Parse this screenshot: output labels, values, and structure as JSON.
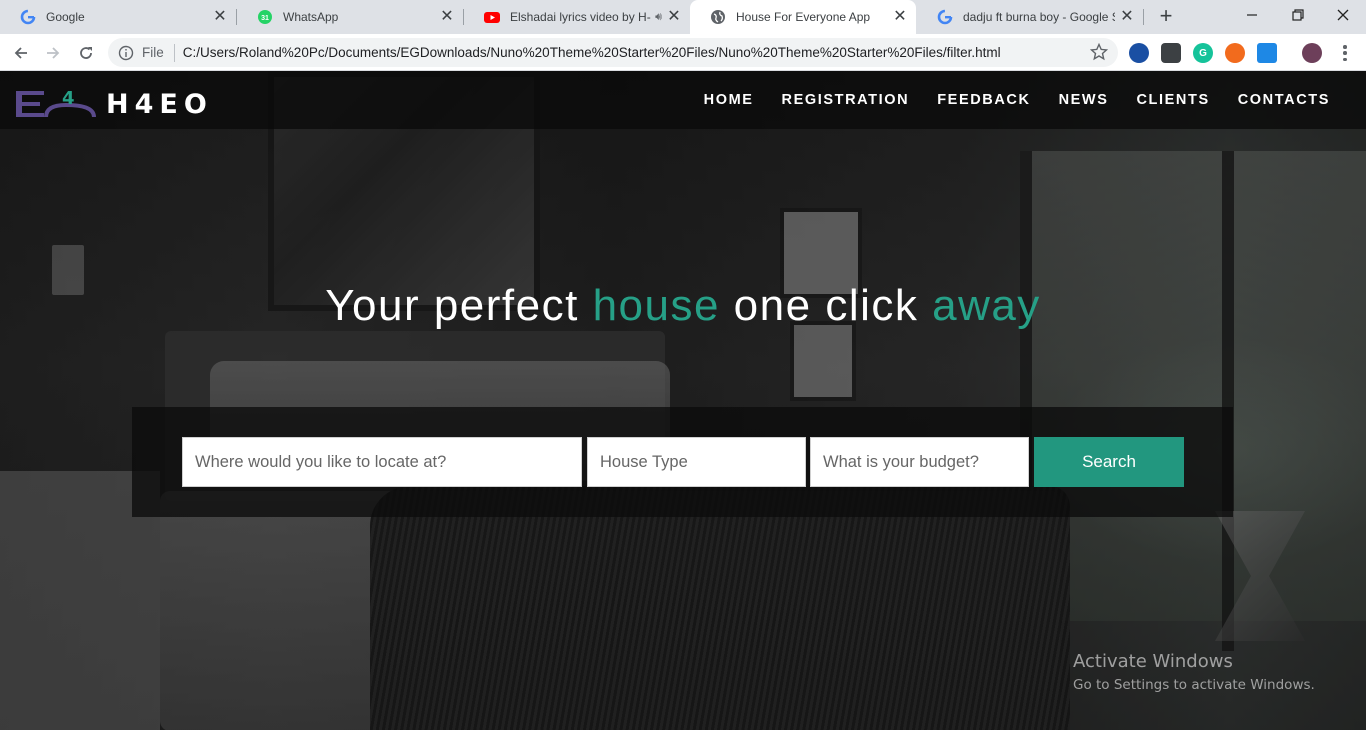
{
  "browser": {
    "tabs": [
      {
        "title": "Google",
        "favicon": "google-icon",
        "active": false
      },
      {
        "title": "WhatsApp",
        "favicon": "whatsapp-icon",
        "badge": "31",
        "active": false
      },
      {
        "title": "Elshadai lyrics video by H-",
        "favicon": "youtube-icon",
        "audio": true,
        "active": false
      },
      {
        "title": "House For Everyone App",
        "favicon": "globe-icon",
        "active": true
      },
      {
        "title": "dadju ft burna boy - Google Se",
        "favicon": "google-icon",
        "active": false
      }
    ],
    "file_label": "File",
    "url": "C:/Users/Roland%20Pc/Documents/EGDownloads/Nuno%20Theme%20Starter%20Files/Nuno%20Theme%20Starter%20Files/filter.html"
  },
  "site": {
    "logo_text": "H4EO",
    "logo_mark_text": "4",
    "nav": [
      "HOME",
      "REGISTRATION",
      "FEEDBACK",
      "NEWS",
      "CLIENTS",
      "CONTACTS"
    ],
    "headline": {
      "part1": "Your perfect ",
      "accent1": "house",
      "part2": " one click ",
      "accent2": "away"
    },
    "search": {
      "location_placeholder": "Where would you like to locate at?",
      "type_placeholder": "House Type",
      "budget_placeholder": "What is your budget?",
      "button_label": "Search"
    },
    "accent_color": "#26a087"
  },
  "watermark": {
    "title": "Activate Windows",
    "subtitle": "Go to Settings to activate Windows."
  }
}
